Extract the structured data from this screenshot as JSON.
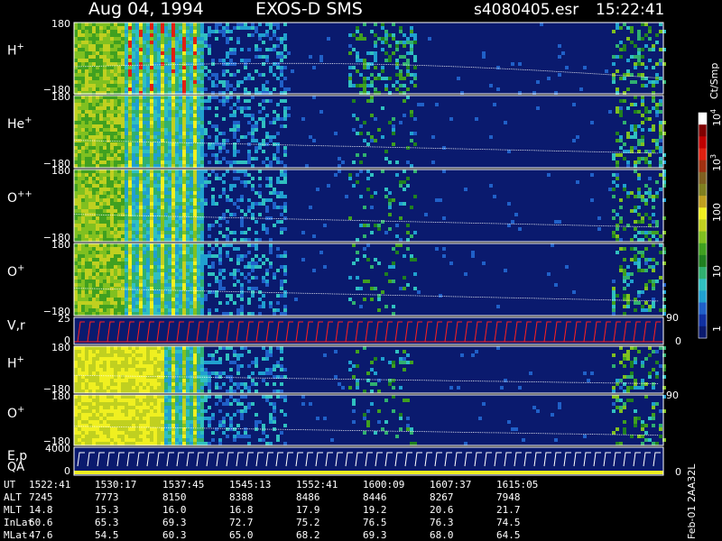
{
  "chart_data": {
    "type": "heatmap",
    "header": {
      "date": "Aug 04, 1994",
      "instrument": "EXOS-D SMS",
      "file": "s4080405.esr",
      "time": "15:22:41"
    },
    "panels": [
      {
        "id": "H+",
        "label": "H",
        "sup": "+",
        "ymax": "180",
        "ymin": "−180",
        "right_label": ""
      },
      {
        "id": "He+",
        "label": "He",
        "sup": "+",
        "ymax": "180",
        "ymin": "−180",
        "right_label": ""
      },
      {
        "id": "O++",
        "label": "O",
        "sup": "++",
        "ymax": "180",
        "ymin": "−180",
        "right_label": ""
      },
      {
        "id": "O+",
        "label": "O",
        "sup": "+",
        "ymax": "180",
        "ymin": "−180",
        "right_label": ""
      },
      {
        "id": "Vr",
        "label": "V,r",
        "sup": "",
        "ymax": "25",
        "ymin": "0",
        "right_top": "90",
        "right_bottom": "0"
      },
      {
        "id": "H+2",
        "label": "H",
        "sup": "+",
        "ymax": "180",
        "ymin": "−180",
        "right_label": ""
      },
      {
        "id": "O+2",
        "label": "O",
        "sup": "+",
        "ymax": "180",
        "ymin": "−180",
        "right_top": "90"
      },
      {
        "id": "Ep",
        "label": "E,p",
        "label2": "QA",
        "sup": "",
        "ymax": "4000",
        "ymin": "0",
        "right_bottom": "0"
      }
    ],
    "colorbar": {
      "unit": "Ct/Smp",
      "ticks": [
        "10",
        "10",
        "100",
        "10",
        "1"
      ],
      "tick_sups": [
        "4",
        "3",
        "",
        "",
        ""
      ],
      "colors": [
        "#0a1a6e",
        "#1030a0",
        "#2060c8",
        "#20a0d0",
        "#30c0c0",
        "#30b070",
        "#208020",
        "#40a020",
        "#80c020",
        "#c0d020",
        "#f0f020",
        "#c0a020",
        "#808020",
        "#806020",
        "#a03010",
        "#e02010",
        "#c00000",
        "#800000",
        "#ffffff"
      ]
    },
    "ephemeris": {
      "rows": [
        {
          "name": "UT",
          "values": [
            "1522:41",
            "1530:17",
            "1537:45",
            "1545:13",
            "1552:41",
            "1600:09",
            "1607:37",
            "1615:05"
          ]
        },
        {
          "name": "ALT",
          "values": [
            "7245",
            "7773",
            "8150",
            "8388",
            "8486",
            "8446",
            "8267",
            "7948"
          ]
        },
        {
          "name": "MLT",
          "values": [
            "14.8",
            "15.3",
            "16.0",
            "16.8",
            "17.9",
            "19.2",
            "20.6",
            "21.7"
          ]
        },
        {
          "name": "InLat",
          "values": [
            "60.6",
            "65.3",
            "69.3",
            "72.7",
            "75.2",
            "76.5",
            "76.3",
            "74.5"
          ]
        },
        {
          "name": "MLat",
          "values": [
            "47.6",
            "54.5",
            "60.3",
            "65.0",
            "68.2",
            "69.3",
            "68.0",
            "64.5"
          ]
        }
      ]
    },
    "footnote": "Feb-01 2AA32L"
  }
}
